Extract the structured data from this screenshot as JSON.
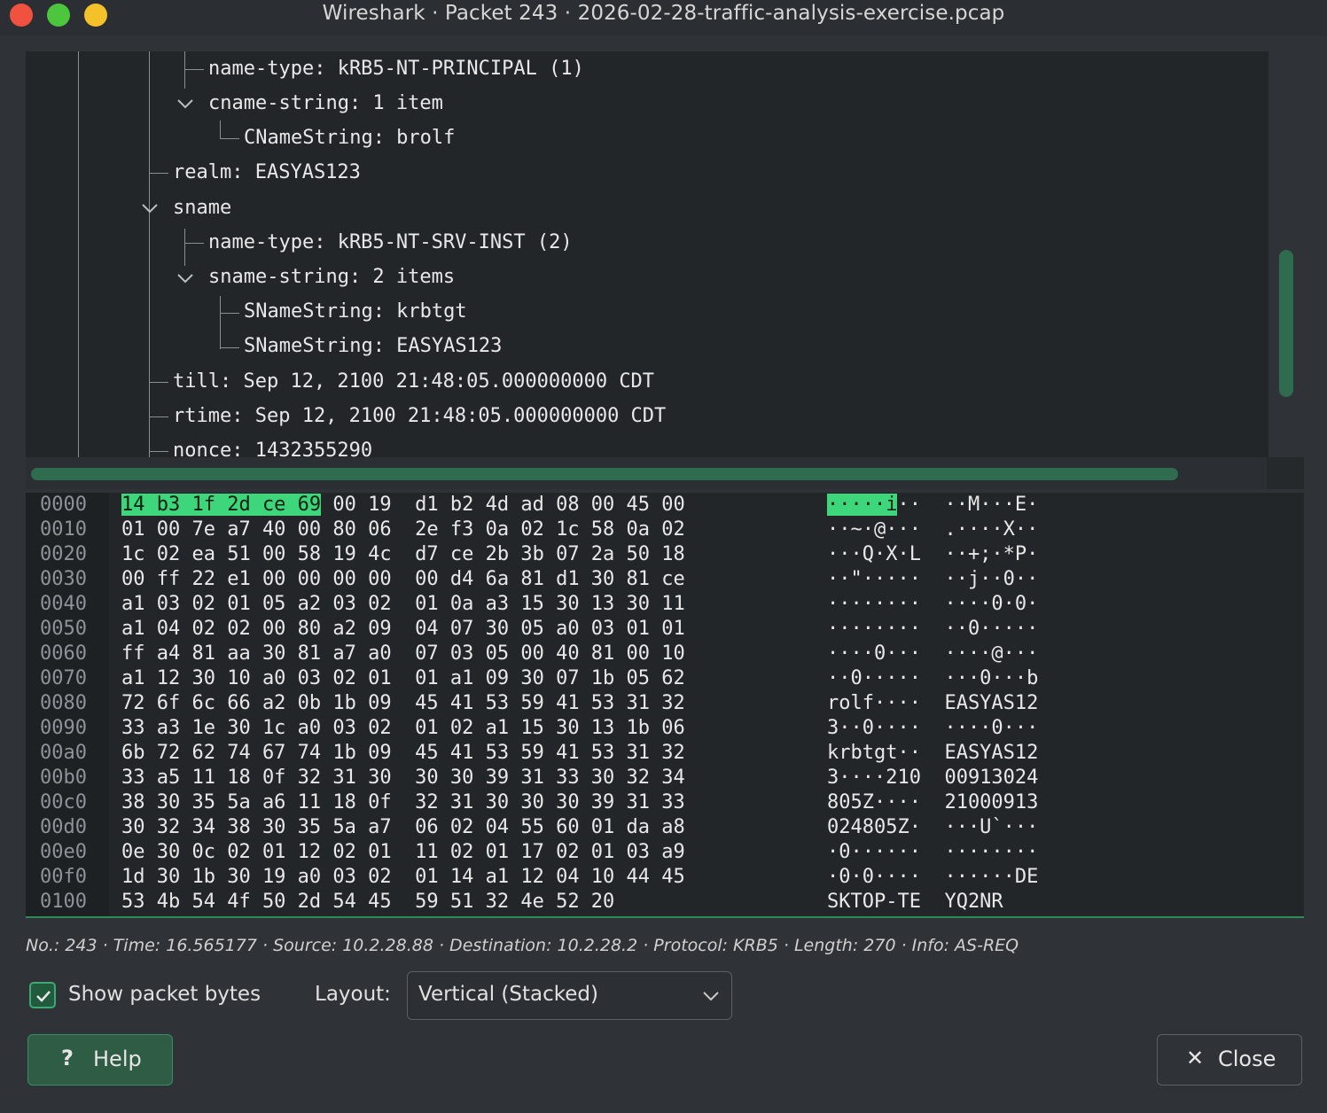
{
  "window": {
    "title": "Wireshark · Packet 243 · 2026-02-28-traffic-analysis-exercise.pcap"
  },
  "tree": {
    "lines": [
      "name-type: kRB5-NT-PRINCIPAL (1)",
      "cname-string: 1 item",
      "CNameString: brolf",
      "realm: EASYAS123",
      "sname",
      "name-type: kRB5-NT-SRV-INST (2)",
      "sname-string: 2 items",
      "SNameString: krbtgt",
      "SNameString: EASYAS123",
      "till: Sep 12, 2100 21:48:05.000000000 CDT",
      "rtime: Sep 12, 2100 21:48:05.000000000 CDT",
      "nonce: 1432355290"
    ]
  },
  "hex": {
    "rows": [
      {
        "offset": "0000",
        "hl": "14 b3 1f 2d ce 69",
        "bytes": " 00 19  d1 b2 4d ad 08 00 45 00",
        "hla": "·····i",
        "ascii": "··  ··M···E·"
      },
      {
        "offset": "0010",
        "hl": "",
        "bytes": "01 00 7e a7 40 00 80 06  2e f3 0a 02 1c 58 0a 02",
        "hla": "",
        "ascii": "··~·@···  .····X··"
      },
      {
        "offset": "0020",
        "hl": "",
        "bytes": "1c 02 ea 51 00 58 19 4c  d7 ce 2b 3b 07 2a 50 18",
        "hla": "",
        "ascii": "···Q·X·L  ··+;·*P·"
      },
      {
        "offset": "0030",
        "hl": "",
        "bytes": "00 ff 22 e1 00 00 00 00  00 d4 6a 81 d1 30 81 ce",
        "hla": "",
        "ascii": "··\"·····  ··j··0··"
      },
      {
        "offset": "0040",
        "hl": "",
        "bytes": "a1 03 02 01 05 a2 03 02  01 0a a3 15 30 13 30 11",
        "hla": "",
        "ascii": "········  ····0·0·"
      },
      {
        "offset": "0050",
        "hl": "",
        "bytes": "a1 04 02 02 00 80 a2 09  04 07 30 05 a0 03 01 01",
        "hla": "",
        "ascii": "········  ··0·····"
      },
      {
        "offset": "0060",
        "hl": "",
        "bytes": "ff a4 81 aa 30 81 a7 a0  07 03 05 00 40 81 00 10",
        "hla": "",
        "ascii": "····0···  ····@···"
      },
      {
        "offset": "0070",
        "hl": "",
        "bytes": "a1 12 30 10 a0 03 02 01  01 a1 09 30 07 1b 05 62",
        "hla": "",
        "ascii": "··0·····  ···0···b"
      },
      {
        "offset": "0080",
        "hl": "",
        "bytes": "72 6f 6c 66 a2 0b 1b 09  45 41 53 59 41 53 31 32",
        "hla": "",
        "ascii": "rolf····  EASYAS12"
      },
      {
        "offset": "0090",
        "hl": "",
        "bytes": "33 a3 1e 30 1c a0 03 02  01 02 a1 15 30 13 1b 06",
        "hla": "",
        "ascii": "3··0····  ····0···"
      },
      {
        "offset": "00a0",
        "hl": "",
        "bytes": "6b 72 62 74 67 74 1b 09  45 41 53 59 41 53 31 32",
        "hla": "",
        "ascii": "krbtgt··  EASYAS12"
      },
      {
        "offset": "00b0",
        "hl": "",
        "bytes": "33 a5 11 18 0f 32 31 30  30 30 39 31 33 30 32 34",
        "hla": "",
        "ascii": "3····210  00913024"
      },
      {
        "offset": "00c0",
        "hl": "",
        "bytes": "38 30 35 5a a6 11 18 0f  32 31 30 30 30 39 31 33",
        "hla": "",
        "ascii": "805Z····  21000913"
      },
      {
        "offset": "00d0",
        "hl": "",
        "bytes": "30 32 34 38 30 35 5a a7  06 02 04 55 60 01 da a8",
        "hla": "",
        "ascii": "024805Z·  ···U`···"
      },
      {
        "offset": "00e0",
        "hl": "",
        "bytes": "0e 30 0c 02 01 12 02 01  11 02 01 17 02 01 03 a9",
        "hla": "",
        "ascii": "·0······  ········"
      },
      {
        "offset": "00f0",
        "hl": "",
        "bytes": "1d 30 1b 30 19 a0 03 02  01 14 a1 12 04 10 44 45",
        "hla": "",
        "ascii": "·0·0····  ······DE"
      },
      {
        "offset": "0100",
        "hl": "",
        "bytes": "53 4b 54 4f 50 2d 54 45  59 51 32 4e 52 20",
        "hla": "",
        "ascii": "SKTOP-TE  YQ2NR"
      }
    ]
  },
  "status": {
    "text": "No.: 243 · Time: 16.565177 · Source: 10.2.28.88 · Destination: 10.2.28.2 · Protocol: KRB5 · Length: 270 · Info: AS-REQ"
  },
  "controls": {
    "show_bytes_label": "Show packet bytes",
    "show_bytes_checked": true,
    "layout_label": "Layout:",
    "layout_value": "Vertical (Stacked)",
    "help_label": "Help",
    "help_icon": "?",
    "close_label": "Close",
    "close_icon": "✕"
  },
  "colors": {
    "accent": "#3dd67a",
    "scroll": "#2f6b4e"
  }
}
